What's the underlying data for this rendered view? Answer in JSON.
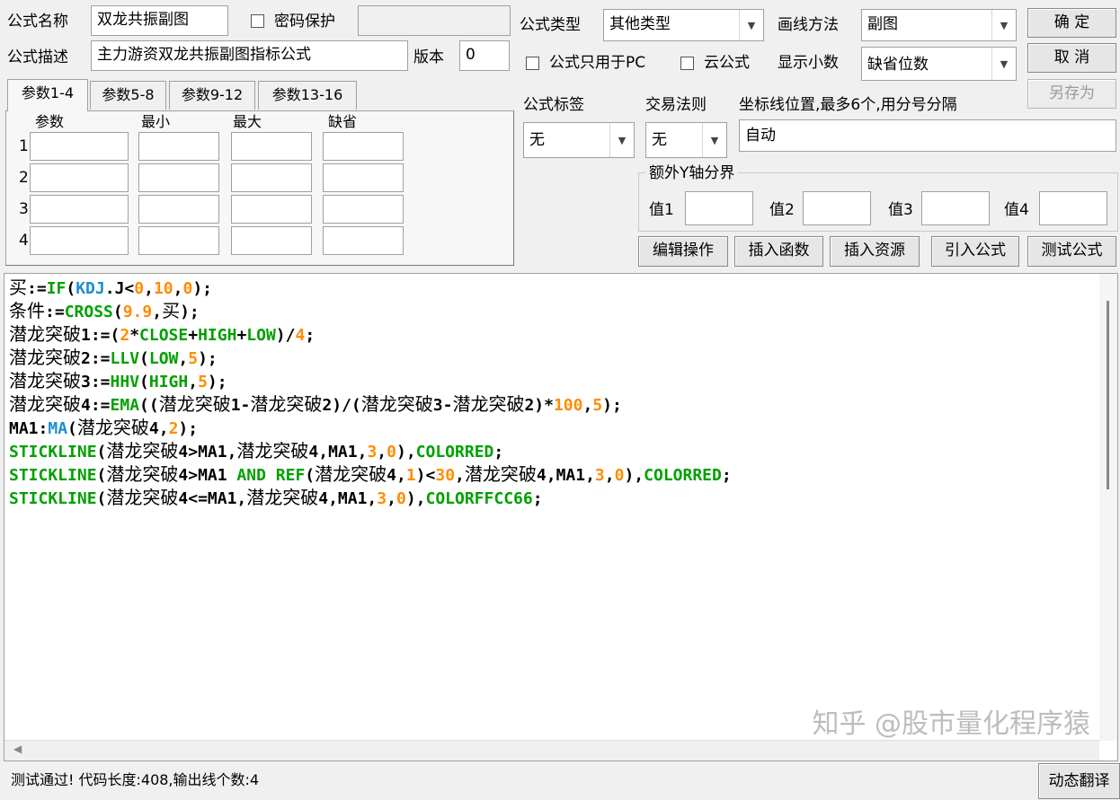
{
  "formula": {
    "name_label": "公式名称",
    "name_value": "双龙共振副图",
    "password_label": "密码保护",
    "desc_label": "公式描述",
    "desc_value": "主力游资双龙共振副图指标公式",
    "version_label": "版本",
    "version_value": "0",
    "type_label": "公式类型",
    "type_value": "其他类型",
    "draw_label": "画线方法",
    "draw_value": "副图",
    "pc_only_label": "公式只用于PC",
    "cloud_label": "云公式",
    "decimals_label": "显示小数",
    "decimals_value": "缺省位数",
    "tag_label": "公式标签",
    "tag_value": "无",
    "trade_label": "交易法则",
    "trade_value": "无",
    "axis_label": "坐标线位置,最多6个,用分号分隔",
    "axis_value": "自动",
    "extra_y_label": "额外Y轴分界",
    "val1": "值1",
    "val2": "值2",
    "val3": "值3",
    "val4": "值4"
  },
  "buttons": {
    "ok": "确 定",
    "cancel": "取 消",
    "save_as": "另存为",
    "edit_ops": "编辑操作",
    "insert_func": "插入函数",
    "insert_res": "插入资源",
    "import_formula": "引入公式",
    "test_formula": "测试公式",
    "dynamic_translate": "动态翻译"
  },
  "params": {
    "tabs": [
      "参数1-4",
      "参数5-8",
      "参数9-12",
      "参数13-16"
    ],
    "headers": [
      "参数",
      "最小",
      "最大",
      "缺省"
    ],
    "rows": [
      "1",
      "2",
      "3",
      "4"
    ]
  },
  "code_lines": [
    [
      {
        "t": "买",
        "c": "cn"
      },
      {
        "t": ":=",
        "c": "d"
      },
      {
        "t": "IF",
        "c": "k"
      },
      {
        "t": "(",
        "c": "d"
      },
      {
        "t": "KDJ",
        "c": "f"
      },
      {
        "t": ".J<",
        "c": "d"
      },
      {
        "t": "0",
        "c": "n"
      },
      {
        "t": ",",
        "c": "d"
      },
      {
        "t": "10",
        "c": "n"
      },
      {
        "t": ",",
        "c": "d"
      },
      {
        "t": "0",
        "c": "n"
      },
      {
        "t": ");",
        "c": "d"
      }
    ],
    [
      {
        "t": "条件",
        "c": "cn"
      },
      {
        "t": ":=",
        "c": "d"
      },
      {
        "t": "CROSS",
        "c": "k"
      },
      {
        "t": "(",
        "c": "d"
      },
      {
        "t": "9.9",
        "c": "n"
      },
      {
        "t": ",",
        "c": "d"
      },
      {
        "t": "买",
        "c": "cn"
      },
      {
        "t": ");",
        "c": "d"
      }
    ],
    [
      {
        "t": "潜龙突破",
        "c": "cn"
      },
      {
        "t": "1:=(",
        "c": "d"
      },
      {
        "t": "2",
        "c": "n"
      },
      {
        "t": "*",
        "c": "d"
      },
      {
        "t": "CLOSE",
        "c": "k"
      },
      {
        "t": "+",
        "c": "d"
      },
      {
        "t": "HIGH",
        "c": "k"
      },
      {
        "t": "+",
        "c": "d"
      },
      {
        "t": "LOW",
        "c": "k"
      },
      {
        "t": ")/",
        "c": "d"
      },
      {
        "t": "4",
        "c": "n"
      },
      {
        "t": ";",
        "c": "d"
      }
    ],
    [
      {
        "t": "潜龙突破",
        "c": "cn"
      },
      {
        "t": "2:=",
        "c": "d"
      },
      {
        "t": "LLV",
        "c": "k"
      },
      {
        "t": "(",
        "c": "d"
      },
      {
        "t": "LOW",
        "c": "k"
      },
      {
        "t": ",",
        "c": "d"
      },
      {
        "t": "5",
        "c": "n"
      },
      {
        "t": ");",
        "c": "d"
      }
    ],
    [
      {
        "t": "潜龙突破",
        "c": "cn"
      },
      {
        "t": "3:=",
        "c": "d"
      },
      {
        "t": "HHV",
        "c": "k"
      },
      {
        "t": "(",
        "c": "d"
      },
      {
        "t": "HIGH",
        "c": "k"
      },
      {
        "t": ",",
        "c": "d"
      },
      {
        "t": "5",
        "c": "n"
      },
      {
        "t": ");",
        "c": "d"
      }
    ],
    [
      {
        "t": "潜龙突破",
        "c": "cn"
      },
      {
        "t": "4:=",
        "c": "d"
      },
      {
        "t": "EMA",
        "c": "k"
      },
      {
        "t": "((",
        "c": "d"
      },
      {
        "t": "潜龙突破",
        "c": "cn"
      },
      {
        "t": "1-",
        "c": "d"
      },
      {
        "t": "潜龙突破",
        "c": "cn"
      },
      {
        "t": "2)/(",
        "c": "d"
      },
      {
        "t": "潜龙突破",
        "c": "cn"
      },
      {
        "t": "3-",
        "c": "d"
      },
      {
        "t": "潜龙突破",
        "c": "cn"
      },
      {
        "t": "2)*",
        "c": "d"
      },
      {
        "t": "100",
        "c": "n"
      },
      {
        "t": ",",
        "c": "d"
      },
      {
        "t": "5",
        "c": "n"
      },
      {
        "t": ");",
        "c": "d"
      }
    ],
    [
      {
        "t": "MA1:",
        "c": "d"
      },
      {
        "t": "MA",
        "c": "f"
      },
      {
        "t": "(",
        "c": "d"
      },
      {
        "t": "潜龙突破",
        "c": "cn"
      },
      {
        "t": "4,",
        "c": "d"
      },
      {
        "t": "2",
        "c": "n"
      },
      {
        "t": ");",
        "c": "d"
      }
    ],
    [
      {
        "t": "STICKLINE",
        "c": "k"
      },
      {
        "t": "(",
        "c": "d"
      },
      {
        "t": "潜龙突破",
        "c": "cn"
      },
      {
        "t": "4>MA1,",
        "c": "d"
      },
      {
        "t": "潜龙突破",
        "c": "cn"
      },
      {
        "t": "4,MA1,",
        "c": "d"
      },
      {
        "t": "3",
        "c": "n"
      },
      {
        "t": ",",
        "c": "d"
      },
      {
        "t": "0",
        "c": "n"
      },
      {
        "t": "),",
        "c": "d"
      },
      {
        "t": "COLORRED",
        "c": "k"
      },
      {
        "t": ";",
        "c": "d"
      }
    ],
    [
      {
        "t": "STICKLINE",
        "c": "k"
      },
      {
        "t": "(",
        "c": "d"
      },
      {
        "t": "潜龙突破",
        "c": "cn"
      },
      {
        "t": "4>MA1 ",
        "c": "d"
      },
      {
        "t": "AND",
        "c": "k"
      },
      {
        "t": " ",
        "c": "d"
      },
      {
        "t": "REF",
        "c": "k"
      },
      {
        "t": "(",
        "c": "d"
      },
      {
        "t": "潜龙突破",
        "c": "cn"
      },
      {
        "t": "4,",
        "c": "d"
      },
      {
        "t": "1",
        "c": "n"
      },
      {
        "t": ")<",
        "c": "d"
      },
      {
        "t": "30",
        "c": "n"
      },
      {
        "t": ",",
        "c": "d"
      },
      {
        "t": "潜龙突破",
        "c": "cn"
      },
      {
        "t": "4,MA1,",
        "c": "d"
      },
      {
        "t": "3",
        "c": "n"
      },
      {
        "t": ",",
        "c": "d"
      },
      {
        "t": "0",
        "c": "n"
      },
      {
        "t": "),",
        "c": "d"
      },
      {
        "t": "COLORRED",
        "c": "k"
      },
      {
        "t": ";",
        "c": "d"
      }
    ],
    [
      {
        "t": "STICKLINE",
        "c": "k"
      },
      {
        "t": "(",
        "c": "d"
      },
      {
        "t": "潜龙突破",
        "c": "cn"
      },
      {
        "t": "4<=MA1,",
        "c": "d"
      },
      {
        "t": "潜龙突破",
        "c": "cn"
      },
      {
        "t": "4,MA1,",
        "c": "d"
      },
      {
        "t": "3",
        "c": "n"
      },
      {
        "t": ",",
        "c": "d"
      },
      {
        "t": "0",
        "c": "n"
      },
      {
        "t": "),",
        "c": "d"
      },
      {
        "t": "COLORFFCC66",
        "c": "k"
      },
      {
        "t": ";",
        "c": "d"
      }
    ]
  ],
  "status": "测试通过! 代码长度:408,输出线个数:4",
  "watermark": "知乎 @股市量化程序猿",
  "colors": {
    "keyword": "#00a000",
    "function": "#1a8fd0",
    "number": "#ff8c00"
  }
}
